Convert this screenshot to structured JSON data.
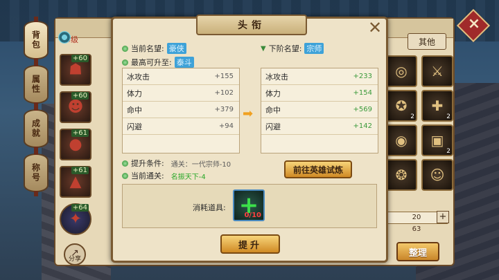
{
  "background": {
    "back_title": "背包",
    "level": "75级",
    "tab_other": "其他",
    "sort_label": "整理",
    "share_label": "分享",
    "qty_value": "20",
    "qty_plus": "+",
    "qty_total": "63"
  },
  "side_tabs": [
    "背包",
    "属性",
    "成就",
    "称号"
  ],
  "left_items": [
    {
      "badge": "+60",
      "glyph": "☗"
    },
    {
      "badge": "+60",
      "glyph": "☻"
    },
    {
      "badge": "+61",
      "glyph": "●"
    },
    {
      "badge": "+61",
      "glyph": "▲"
    },
    {
      "badge": "+64",
      "glyph": "✦"
    }
  ],
  "right_items": [
    {
      "glyph": "◎",
      "count": ""
    },
    {
      "glyph": "⚔",
      "count": ""
    },
    {
      "glyph": "✪",
      "count": "2"
    },
    {
      "glyph": "✚",
      "count": "2"
    },
    {
      "glyph": "◉",
      "count": ""
    },
    {
      "glyph": "▣",
      "count": "2"
    },
    {
      "glyph": "❂",
      "count": ""
    },
    {
      "glyph": "☺",
      "count": ""
    }
  ],
  "dialog": {
    "title": "头衔",
    "close": "✕",
    "current_rank_label": "当前名望:",
    "current_rank_value": "豪侠",
    "max_rank_label": "最高可升至:",
    "max_rank_value": "泰斗",
    "next_rank_label": "下阶名望:",
    "next_rank_value": "宗师",
    "current_stats": [
      {
        "name": "冰攻击",
        "value": "+155"
      },
      {
        "name": "体力",
        "value": "+102"
      },
      {
        "name": "命中",
        "value": "+379"
      },
      {
        "name": "闪避",
        "value": "+94"
      }
    ],
    "next_stats": [
      {
        "name": "冰攻击",
        "value": "+233"
      },
      {
        "name": "体力",
        "value": "+154"
      },
      {
        "name": "命中",
        "value": "+569"
      },
      {
        "name": "闪避",
        "value": "+142"
      }
    ],
    "condition_label": "提升条件:",
    "condition_value": "通关：一代宗师-10",
    "current_clear_label": "当前通关:",
    "current_clear_value": "名振天下-4",
    "hero_button": "前往英雄试炼",
    "consume_label": "消耗道具:",
    "consume_count": "0/10",
    "upgrade_button": "提升"
  },
  "colors": {
    "rank_badge": "#3ea2d8",
    "green_value": "#3a9a3a",
    "button_gold": "#f7d47a"
  }
}
